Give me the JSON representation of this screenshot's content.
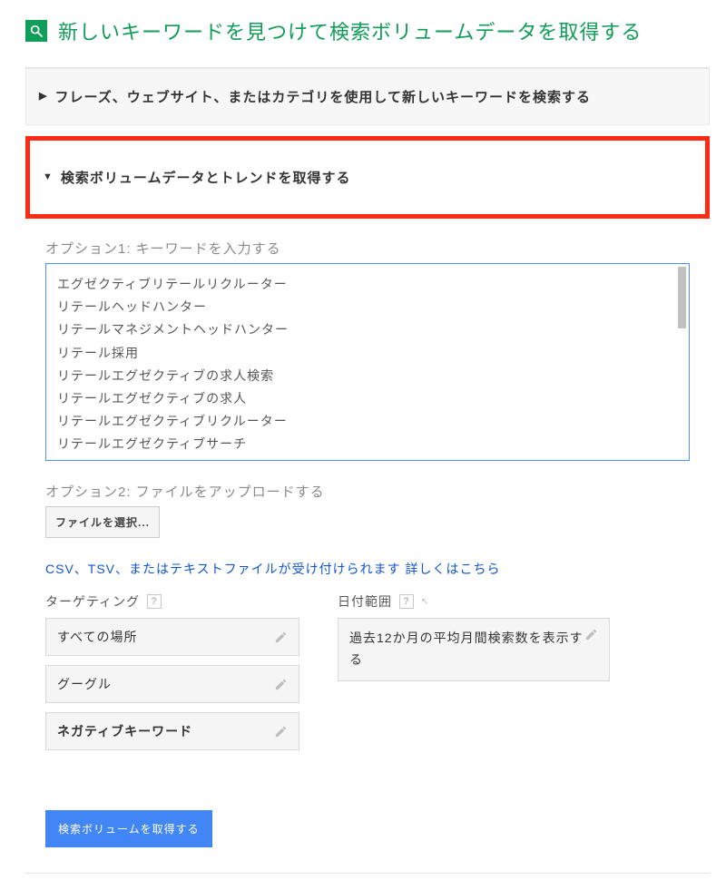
{
  "title": "新しいキーワードを見つけて検索ボリュームデータを取得する",
  "accordion": {
    "collapsed": "フレーズ、ウェブサイト、またはカテゴリを使用して新しいキーワードを検索する",
    "expanded": "検索ボリュームデータとトレンドを取得する"
  },
  "option1": {
    "label": "オプション1: キーワードを入力する",
    "keywords": "エグゼクティブリテールリクルーター\nリテールヘッドハンター\nリテールマネジメントヘッドハンター\nリテール採用\nリテールエグゼクティブの求人検索\nリテールエグゼクティブの求人\nリテールエグゼクティブリクルーター\nリテールエグゼクティブサーチ"
  },
  "option2": {
    "label": "オプション2: ファイルをアップロードする",
    "button": "ファイルを選択..."
  },
  "hint": {
    "text": "CSV、TSV、またはテキストファイルが受け付けられます ",
    "link": "詳しくはこちら"
  },
  "targeting": {
    "header": "ターゲティング",
    "items": {
      "location": "すべての場所",
      "network": "グーグル",
      "negative": "ネガティブキーワード"
    }
  },
  "daterange": {
    "header": "日付範囲",
    "value": "過去12か月の平均月間検索数を表示する"
  },
  "submit": "検索ボリュームを取得する"
}
